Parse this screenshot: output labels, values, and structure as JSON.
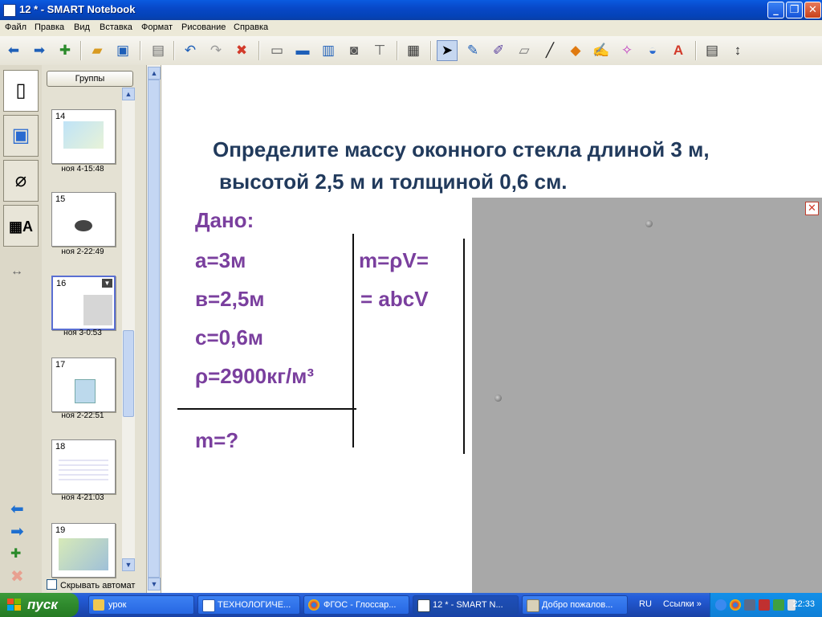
{
  "window": {
    "title": "12 * - SMART Notebook",
    "minimize_glyph": "_",
    "maximize_glyph": "❐",
    "close_glyph": "✕"
  },
  "menu": [
    "Файл",
    "Правка",
    "Вид",
    "Вставка",
    "Формат",
    "Рисование",
    "Справка"
  ],
  "toolbar": {
    "buttons": [
      "back-arrow",
      "forward-arrow",
      "add-page",
      "open-file",
      "save",
      "paste",
      "undo",
      "redo",
      "delete",
      "screen-shade",
      "full-screen",
      "dual-page",
      "screen-capture",
      "document-camera",
      "table",
      "select-pointer",
      "pen",
      "creative-pen",
      "eraser",
      "line",
      "shapes",
      "magic-pen",
      "fill",
      "text",
      "properties",
      "move-toolbar"
    ]
  },
  "side_tabs": [
    "page-sorter",
    "gallery",
    "attachments",
    "properties"
  ],
  "sorter": {
    "groups_label": "Группы",
    "autohide_label": "Скрывать автомат",
    "pages": [
      {
        "num": "14",
        "label": "ноя 4-15:48",
        "selected": false
      },
      {
        "num": "15",
        "label": "ноя 2-22:49",
        "selected": false
      },
      {
        "num": "16",
        "label": "ноя 3-0:53",
        "selected": true
      },
      {
        "num": "17",
        "label": "ноя 2-22:51",
        "selected": false
      },
      {
        "num": "18",
        "label": "ноя 4-21:03",
        "selected": false
      },
      {
        "num": "19",
        "label": "",
        "selected": false
      }
    ]
  },
  "slide": {
    "question_line1": "Определите массу оконного  стекла длиной  3 м,",
    "question_line2": "высотой 2,5 м и толщиной  0,6 см.",
    "given_title": "Дано:",
    "given": [
      "а=3м",
      "в=2,5м",
      "с=0,6м",
      "ρ=2900кг/м³"
    ],
    "find": "m=?",
    "solution": [
      "m=ρV=",
      "= abcV"
    ],
    "shade_close": "✕"
  },
  "taskbar": {
    "start_label": "пуск",
    "tasks": [
      {
        "label": "урок",
        "active": false
      },
      {
        "label": "ТЕХНОЛОГИЧЕ...",
        "active": false
      },
      {
        "label": "ФГОС - Глоссар...",
        "active": false
      },
      {
        "label": "12 * - SMART N...",
        "active": true
      },
      {
        "label": "Добро пожалов...",
        "active": false
      }
    ],
    "lang": "RU",
    "links_label": "Ссылки",
    "links_chevron": "»",
    "time": "22:33"
  }
}
